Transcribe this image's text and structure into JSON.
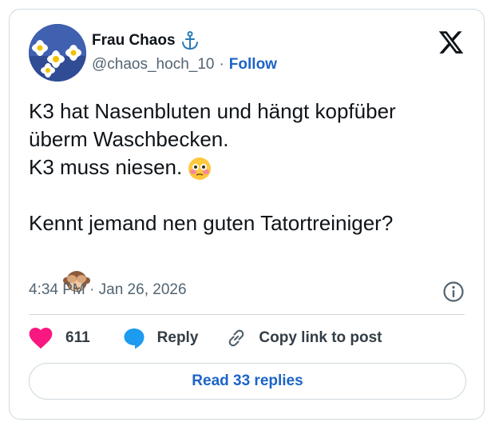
{
  "tweet": {
    "author": {
      "name": "Frau Chaos",
      "handle": "@chaos_hoch_10",
      "follow_label": "Follow",
      "separator": "·"
    },
    "body_lines": [
      "K3 hat Nasenbluten und hängt kopfüber",
      "überm Waschbecken.",
      "K3 muss niesen."
    ],
    "body_lines_2": [
      "Kennt jemand nen guten Tatortreiniger?"
    ],
    "emojis": [
      "flushed-face",
      "see-no-evil-monkey"
    ],
    "timestamp": "4:34 PM · Jan 26, 2026",
    "actions": {
      "likes": "611",
      "reply_label": "Reply",
      "copy_label": "Copy link to post"
    },
    "read_replies_label": "Read 33 replies"
  },
  "colors": {
    "accent": "#1d64c7",
    "heart": "#f91880",
    "reply_bubble": "#1d9bf0",
    "muted": "#536471",
    "border": "#cfd9de"
  }
}
